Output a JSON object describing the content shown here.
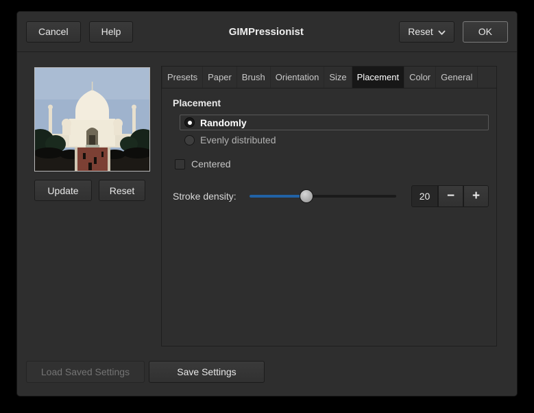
{
  "window": {
    "title": "GIMPressionist"
  },
  "header": {
    "cancel_label": "Cancel",
    "help_label": "Help",
    "reset_label": "Reset",
    "ok_label": "OK"
  },
  "preview": {
    "update_label": "Update",
    "reset_label": "Reset",
    "image_description": "taj-mahal-photo-preview"
  },
  "tabs": [
    {
      "label": "Presets",
      "selected": false
    },
    {
      "label": "Paper",
      "selected": false
    },
    {
      "label": "Brush",
      "selected": false
    },
    {
      "label": "Orientation",
      "selected": false
    },
    {
      "label": "Size",
      "selected": false
    },
    {
      "label": "Placement",
      "selected": true
    },
    {
      "label": "Color",
      "selected": false
    },
    {
      "label": "General",
      "selected": false
    }
  ],
  "placement_panel": {
    "heading": "Placement",
    "options": [
      {
        "label": "Randomly",
        "selected": true
      },
      {
        "label": "Evenly distributed",
        "selected": false
      }
    ],
    "centered_label": "Centered",
    "centered_checked": false,
    "stroke_density": {
      "label": "Stroke density:",
      "value": "20",
      "minus_label": "−",
      "plus_label": "+"
    }
  },
  "footer": {
    "load_label": "Load Saved Settings",
    "load_enabled": false,
    "save_label": "Save Settings"
  },
  "colors": {
    "accent_blue": "#2162a5",
    "dialog_bg": "#2e2e2e",
    "selected_tab_bg": "#171717"
  }
}
